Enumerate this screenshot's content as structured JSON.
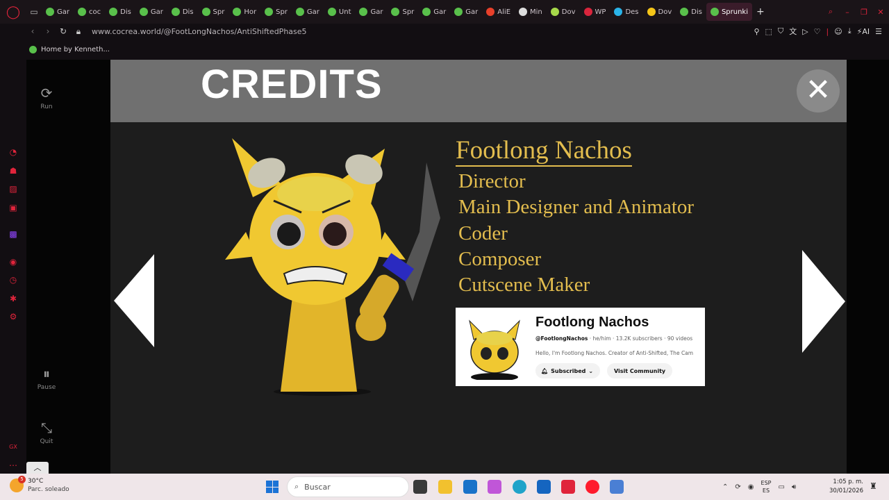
{
  "browser": {
    "tabs": [
      {
        "label": "Gar",
        "color": "#59c04b"
      },
      {
        "label": "coc",
        "color": "#59c04b"
      },
      {
        "label": "Dis",
        "color": "#59c04b"
      },
      {
        "label": "Gar",
        "color": "#59c04b"
      },
      {
        "label": "Dis",
        "color": "#59c04b"
      },
      {
        "label": "Spr",
        "color": "#59c04b"
      },
      {
        "label": "Hor",
        "color": "#59c04b"
      },
      {
        "label": "Spr",
        "color": "#59c04b"
      },
      {
        "label": "Gar",
        "color": "#59c04b"
      },
      {
        "label": "Unt",
        "color": "#59c04b"
      },
      {
        "label": "Gar",
        "color": "#59c04b"
      },
      {
        "label": "Spr",
        "color": "#59c04b"
      },
      {
        "label": "Gar",
        "color": "#59c04b"
      },
      {
        "label": "Gar",
        "color": "#59c04b"
      },
      {
        "label": "AliE",
        "color": "#e8402a"
      },
      {
        "label": "Min",
        "color": "#dddddd"
      },
      {
        "label": "Dov",
        "color": "#a6d84a"
      },
      {
        "label": "WP",
        "color": "#d9253c"
      },
      {
        "label": "Des",
        "color": "#2ab3e8"
      },
      {
        "label": "Dov",
        "color": "#f5c518"
      },
      {
        "label": "Dis",
        "color": "#59c04b"
      }
    ],
    "active_tab": "Sprunki",
    "active_tab_color": "#59c04b",
    "new_tab_glyph": "+",
    "url": "www.cocrea.world/@FootLongNachos/AntiShiftedPhase5",
    "ai_label": "AI",
    "bookmark": "Home by Kenneth..."
  },
  "cocrea_panel": {
    "run_label": "Run",
    "pause_label": "Pause",
    "quit_label": "Quit",
    "collapse_glyph": "︿"
  },
  "game": {
    "header_title": "CREDITS",
    "close_glyph": "✕",
    "credit_name": "Footlong Nachos",
    "roles": [
      "Director",
      "Main Designer and Animator",
      "Coder",
      "Composer",
      "Cutscene Maker"
    ],
    "channel": {
      "name": "Footlong Nachos",
      "handle": "@FootlongNachos",
      "meta": " · he/him · 13.2K subscribers · 90 videos",
      "description": "Hello, I'm Footlong Nachos. Creator of Anti-Shifted, The Cam",
      "subscribed_label": "Subscribed",
      "visit_label": "Visit Community"
    },
    "colors": {
      "header": "#707070",
      "text_gold": "#e3bd4e",
      "background": "#1d1d1d"
    }
  },
  "taskbar": {
    "temperature": "30°C",
    "condition": "Parc. soleado",
    "weather_badge": "5",
    "search_placeholder": "Buscar",
    "lang_top": "ESP",
    "lang_bottom": "ES",
    "time": "1:05 p. m.",
    "date": "30/01/2026"
  }
}
